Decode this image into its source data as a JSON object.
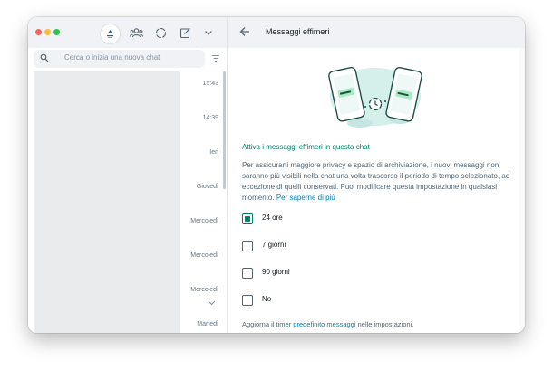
{
  "sidebar": {
    "search_placeholder": "Cerca o inizia una nuova chat",
    "chats": [
      {
        "time": "15:43"
      },
      {
        "time": "14:39"
      },
      {
        "time": "Ieri"
      },
      {
        "time": "Giovedì"
      },
      {
        "time": "Mercoledì"
      },
      {
        "time": "Mercoledì"
      },
      {
        "time": "Mercoledì"
      },
      {
        "time": "Martedì"
      }
    ]
  },
  "panel": {
    "title": "Messaggi effimeri",
    "section_title": "Attiva i messaggi effimeri in questa chat",
    "description": "Per assicurarti maggiore privacy e spazio di archiviazione, i nuovi messaggi non saranno più visibili nella chat una volta trascorso il periodo di tempo selezionato, ad eccezione di quelli conservati. Puoi modificare questa impostazione in qualsiasi momento.",
    "learn_more": "Per saperne di più",
    "options": [
      {
        "label": "24 ore",
        "checked": true
      },
      {
        "label": "7 giorni",
        "checked": false
      },
      {
        "label": "90 giorni",
        "checked": false
      },
      {
        "label": "No",
        "checked": false
      }
    ],
    "footer_prefix": "Aggiorna il",
    "footer_link": "timer predefinito messaggi",
    "footer_suffix": "nelle impostazioni."
  },
  "colors": {
    "accent": "#008069",
    "link": "#027eb5"
  }
}
